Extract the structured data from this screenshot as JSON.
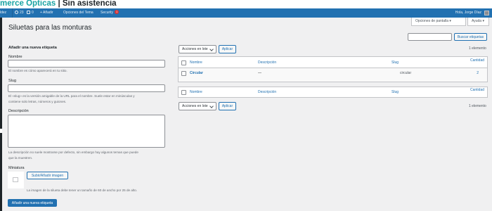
{
  "banner": {
    "part1": "merce Ópticas",
    "part2": " | Sin asistencia"
  },
  "adminbar": {
    "user_fragment": "ldez",
    "updates_count": "23",
    "comments_count": "0",
    "add_new": "+ Añadir",
    "theme_options": "Opciones del Tema",
    "security": "Security",
    "security_badge": "1",
    "greeting": "Hola, Jorge Díaz"
  },
  "screen_options": {
    "screen_label": "Opciones de pantalla ▾",
    "help_label": "Ayuda ▾"
  },
  "page": {
    "title": "Siluetas para las monturas"
  },
  "search": {
    "placeholder": "",
    "button": "Buscar etiquetas"
  },
  "form": {
    "heading": "Añadir una nueva etiqueta",
    "name_label": "Nombre",
    "name_value": "",
    "name_help": "El nombre es cómo aparecerá en tu sitio.",
    "slug_label": "Slug",
    "slug_value": "",
    "slug_help_1": "El «slug» es la versión amigable de la URL para el nombre. Suele estar en minúsculas y",
    "slug_help_2": "contiene solo letras, números y guiones.",
    "desc_label": "Descripción",
    "desc_value": "",
    "desc_help_1": "La descripción no suele mostrarse por defecto, sin embargo hay algunos temas que puede",
    "desc_help_2": "que la muestren.",
    "thumb_label": "Miniatura",
    "upload_button": "Subir/Añadir imagen",
    "thumb_help": "La imagen de la silueta debe tener un tamaño de 60 de ancho por 25 de alto.",
    "submit_button": "Añadir una nueva etiqueta"
  },
  "list": {
    "bulk_label": "Acciones en lote",
    "apply": "Aplicar",
    "count": "1 elemento",
    "columns": [
      "Nombre",
      "Descripción",
      "Slug",
      "Cantidad"
    ],
    "rows": [
      {
        "name": "Circular",
        "description": "—",
        "slug": "circular",
        "count": "2"
      }
    ]
  },
  "colors": {
    "accent": "#2271b1",
    "banner_teal": "#1aa3a3",
    "badge_red": "#d63638"
  }
}
